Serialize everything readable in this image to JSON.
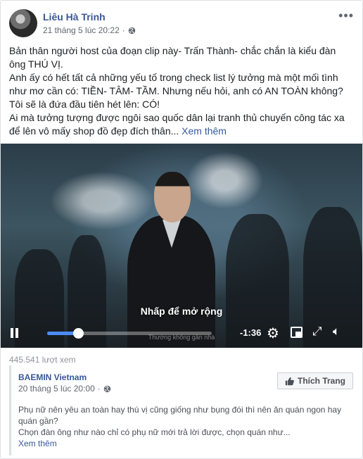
{
  "post": {
    "author": "Liêu Hà Trinh",
    "timestamp": "21 tháng 5 lúc 20:22",
    "privacy_icon": "globe-icon",
    "more_glyph": "•••",
    "lines": [
      "Bản thân người host của đoạn clip này- Trấn Thành- chắc chắn là kiểu đàn ông THÚ VỊ.",
      "Anh ấy có hết tất cả những yếu tố trong check list lý tưởng mà một mối tình như mơ cần có: TIỀN- TÂM- TẦM. Nhưng nếu hỏi, anh có AN TOÀN không?",
      "Tôi sẽ là đứa đầu tiên hét lên: CÓ!",
      "Ai mà tưởng tượng được ngôi sao quốc dân lại tranh thủ chuyến công tác xa để lên vô mấy shop đồ đẹp đích thân..."
    ],
    "see_more": "Xem thêm"
  },
  "video": {
    "expand_hint": "Nhấp để mở rộng",
    "time_remaining": "-1:36",
    "progress": 0.19,
    "caption": "Thường không gần nhà",
    "views": "445.541 lượt xem"
  },
  "shared": {
    "page_name": "BAEMIN Vietnam",
    "timestamp": "20 tháng 5 lúc 20:00",
    "like_button": "Thích Trang",
    "text": "Phụ nữ nên yêu an toàn hay thú vị cũng giống như bụng đói thì nên ăn quán ngon hay quán gần?",
    "text2": "Chọn đàn ông như nào chỉ có phụ nữ mới trả lời được, chọn quán như...",
    "see_more": "Xem thêm"
  },
  "colors": {
    "link": "#385898",
    "progress": "#4b8bf5"
  }
}
